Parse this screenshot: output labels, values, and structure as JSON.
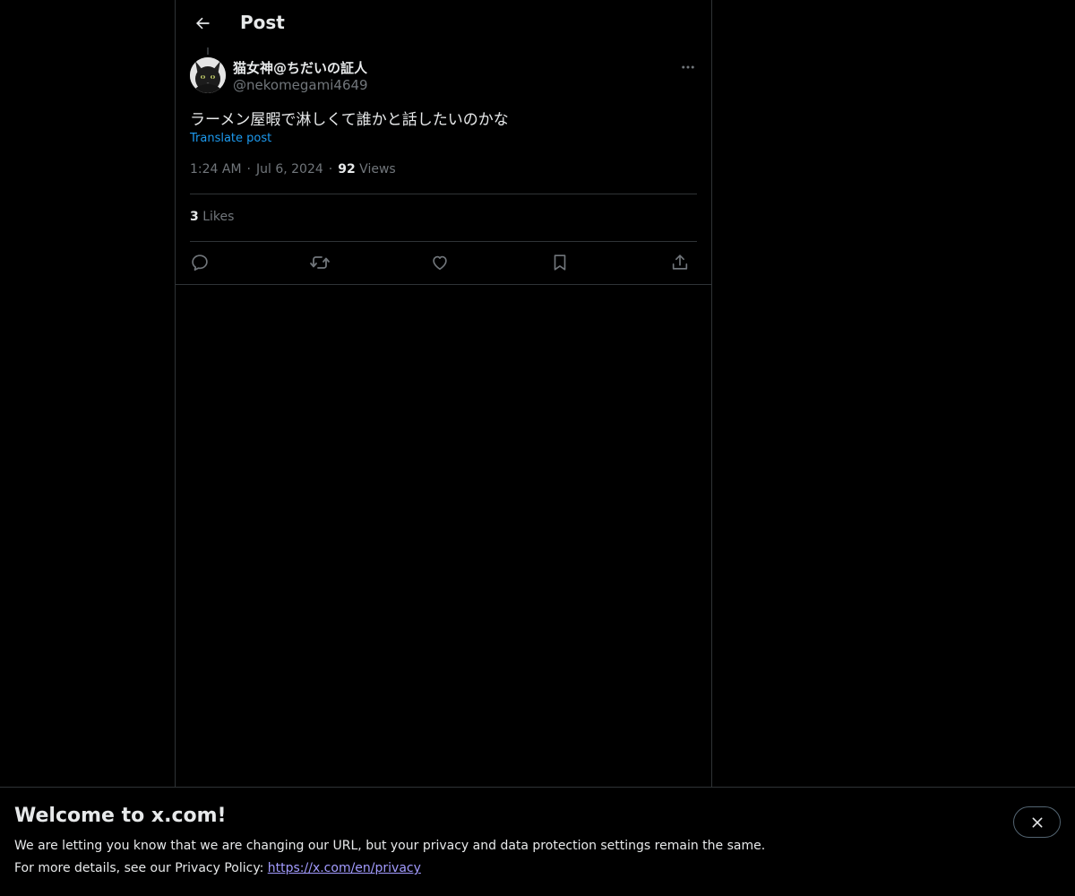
{
  "header": {
    "title": "Post",
    "back_icon": "arrow-left-icon"
  },
  "post": {
    "author": {
      "display_name": "猫女神@ちだいの証人",
      "handle": "@nekomegami4649",
      "avatar_icon": "black-cat-avatar"
    },
    "text": "ラーメン屋暇で淋しくて誰かと話したいのかな",
    "translate_label": "Translate post",
    "time": "1:24 AM",
    "date": "Jul 6, 2024",
    "separator": "·",
    "views_count": "92",
    "views_label": "Views",
    "likes_count": "3",
    "likes_label": "Likes",
    "actions": [
      {
        "name": "reply",
        "icon": "reply-icon"
      },
      {
        "name": "repost",
        "icon": "repost-icon"
      },
      {
        "name": "like",
        "icon": "heart-icon"
      },
      {
        "name": "bookmark",
        "icon": "bookmark-icon"
      },
      {
        "name": "share",
        "icon": "share-icon"
      }
    ]
  },
  "banner": {
    "title": "Welcome to x.com!",
    "line1": "We are letting you know that we are changing our URL, but your privacy and data protection settings remain the same.",
    "line2_prefix": "For more details, see our Privacy Policy: ",
    "link_text": "https://x.com/en/privacy",
    "close_icon": "close-icon"
  },
  "colors": {
    "background": "#000000",
    "text": "#e7e9ea",
    "secondary_text": "#71767b",
    "accent": "#1d9bf0",
    "border": "#2f3336",
    "link_visited": "#a29bfe"
  }
}
